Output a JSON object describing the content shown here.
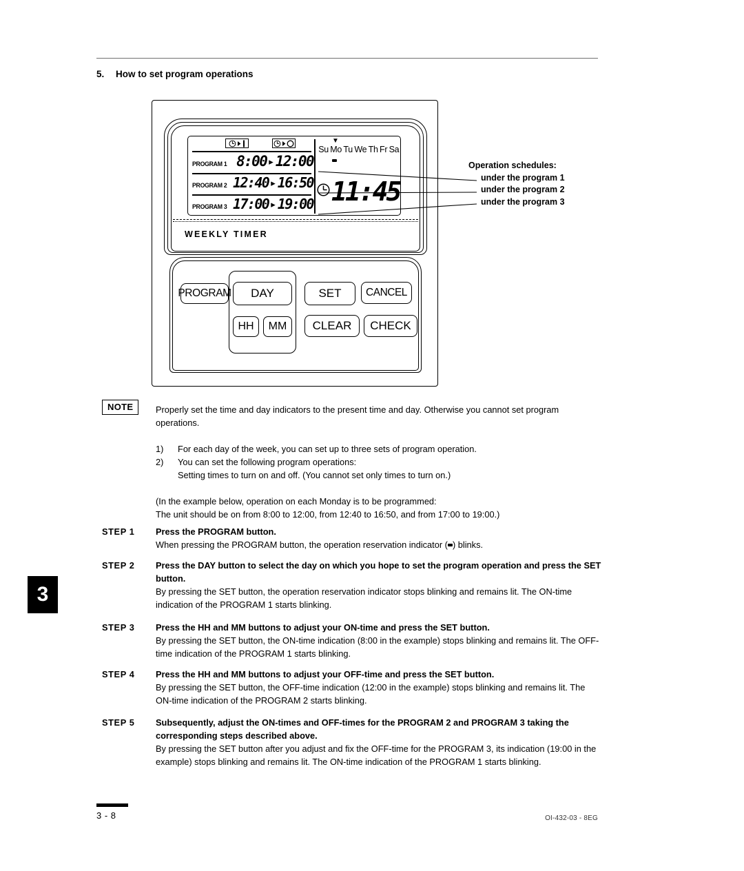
{
  "page": {
    "section_number": "5.",
    "section_title": "How to set program operations",
    "chapter_tab": "3",
    "footer_page": "3 - 8",
    "footer_code": "OI-432-03 - 8EG"
  },
  "device": {
    "brand_label": "WEEKLY TIMER",
    "lcd": {
      "on_icon": "clock-to-bar-icon",
      "off_icon": "clock-to-circle-icon",
      "programs": [
        {
          "label": "PROGRAM 1",
          "on_time": "8:00",
          "arrow": "▸",
          "off_time": "12:00"
        },
        {
          "label": "PROGRAM 2",
          "on_time": "12:40",
          "arrow": "▸",
          "off_time": "16:50"
        },
        {
          "label": "PROGRAM 3",
          "on_time": "17:00",
          "arrow": "▸",
          "off_time": "19:00"
        }
      ],
      "days": [
        "Su",
        "Mo",
        "Tu",
        "We",
        "Th",
        "Fr",
        "Sa"
      ],
      "selected_day": "Mo",
      "day_marker": "▼",
      "reservation_indicator": "filled-dot",
      "clock_icon": "clock-icon",
      "clock_time": "11:45"
    },
    "buttons": [
      {
        "name": "program",
        "label": "PROGRAM"
      },
      {
        "name": "day",
        "label": "DAY"
      },
      {
        "name": "set",
        "label": "SET"
      },
      {
        "name": "cancel",
        "label": "CANCEL"
      },
      {
        "name": "hh",
        "label": "HH"
      },
      {
        "name": "mm",
        "label": "MM"
      },
      {
        "name": "clear",
        "label": "CLEAR"
      },
      {
        "name": "check",
        "label": "CHECK"
      }
    ]
  },
  "callouts": {
    "heading": "Operation schedules:",
    "lines": [
      "under the program 1",
      "under the program 2",
      "under the program 3"
    ]
  },
  "note": {
    "badge": "NOTE",
    "paragraph": "Properly set the time and day indicators to the present time and day. Otherwise you cannot set program operations.",
    "items": [
      {
        "marker": "1)",
        "text": "For each day of the week, you can set up to three sets of program operation."
      },
      {
        "marker": "2)",
        "text": "You can set the following program operations:"
      }
    ],
    "item2_continued": "Setting times to turn on and off. (You cannot set only times to turn on.)",
    "example_line1": "(In the example below, operation on each Monday is to be programmed:",
    "example_line2": "The unit should be on from 8:00 to 12:00, from 12:40 to 16:50, and from 17:00 to 19:00.)"
  },
  "steps": [
    {
      "label": "STEP 1",
      "title": "Press the PROGRAM button.",
      "detail_pre": "When pressing the PROGRAM button, the operation reservation indicator (",
      "detail_post": ") blinks."
    },
    {
      "label": "STEP 2",
      "title": "Press the DAY button to select the day on which you hope to set the program operation and press the SET button.",
      "detail": "By pressing the SET button, the operation reservation indicator stops blinking and remains lit. The ON-time indication of the PROGRAM 1 starts blinking."
    },
    {
      "label": "STEP 3",
      "title": "Press the HH and MM buttons to adjust your ON-time and press the SET button.",
      "detail": "By pressing the SET button, the ON-time indication (8:00 in the example) stops blinking and remains lit. The OFF-time indication of the PROGRAM 1 starts blinking."
    },
    {
      "label": "STEP 4",
      "title": "Press the HH and MM buttons to adjust your OFF-time and press the SET button.",
      "detail": "By pressing the SET button, the OFF-time indication (12:00 in the example) stops blinking and remains lit. The ON-time indication of the PROGRAM 2 starts blinking."
    },
    {
      "label": "STEP 5",
      "title": "Subsequently, adjust the ON-times and OFF-times for the PROGRAM 2 and PROGRAM 3 taking the corresponding steps described above.",
      "detail": "By pressing the SET button after you adjust and fix the OFF-time for the PROGRAM 3, its indication (19:00 in the example) stops blinking and remains lit. The ON-time indication of the PROGRAM 1 starts blinking."
    }
  ],
  "colors": {
    "ink": "#000000",
    "rule": "#6f6f6f"
  }
}
